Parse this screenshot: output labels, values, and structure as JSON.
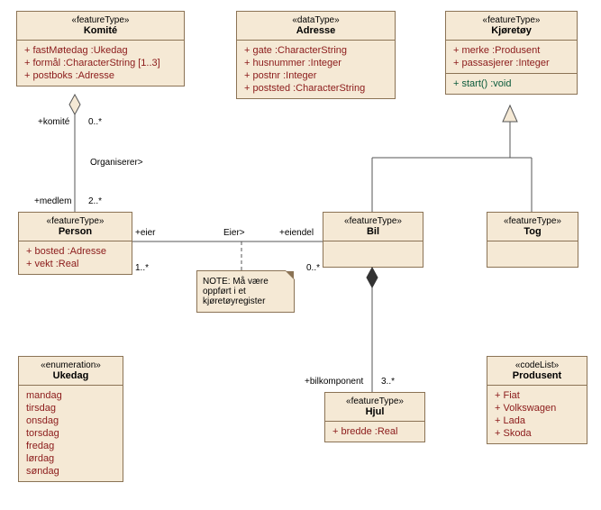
{
  "classes": {
    "komite": {
      "stereo": "«featureType»",
      "name": "Komité",
      "attrs": [
        "+  fastMøtedag :Ukedag",
        "+  formål :CharacterString [1..3]",
        "+  postboks :Adresse"
      ]
    },
    "adresse": {
      "stereo": "«dataType»",
      "name": "Adresse",
      "attrs": [
        "+  gate :CharacterString",
        "+  husnummer :Integer",
        "+  postnr :Integer",
        "+  poststed :CharacterString"
      ]
    },
    "kjoretoy": {
      "stereo": "«featureType»",
      "name": "Kjøretøy",
      "attrs": [
        "+  merke :Produsent",
        "+  passasjerer :Integer"
      ],
      "ops": [
        "+  start() :void"
      ]
    },
    "person": {
      "stereo": "«featureType»",
      "name": "Person",
      "attrs": [
        "+  bosted :Adresse",
        "+  vekt :Real"
      ]
    },
    "bil": {
      "stereo": "«featureType»",
      "name": "Bil"
    },
    "tog": {
      "stereo": "«featureType»",
      "name": "Tog"
    },
    "ukedag": {
      "stereo": "«enumeration»",
      "name": "Ukedag",
      "attrs": [
        "mandag",
        "tirsdag",
        "onsdag",
        "torsdag",
        "fredag",
        "lørdag",
        "søndag"
      ]
    },
    "hjul": {
      "stereo": "«featureType»",
      "name": "Hjul",
      "attrs": [
        "+  bredde :Real"
      ]
    },
    "produsent": {
      "stereo": "«codeList»",
      "name": "Produsent",
      "attrs": [
        "+  Fiat",
        "+  Volkswagen",
        "+  Lada",
        "+  Skoda"
      ]
    }
  },
  "labels": {
    "komiteRole": "+komité",
    "komiteMult": "0..*",
    "organiser": "Organiserer>",
    "medlemRole": "+medlem",
    "medlemMult": "2..*",
    "eierRole": "+eier",
    "eierMult": "1..*",
    "eier": "Eier>",
    "eiendelRole": "+eiendel",
    "eiendelMult": "0..*",
    "bilkompRole": "+bilkomponent",
    "bilkompMult": "3..*"
  },
  "note": "NOTE: Må være oppført i et kjøretøyregister"
}
